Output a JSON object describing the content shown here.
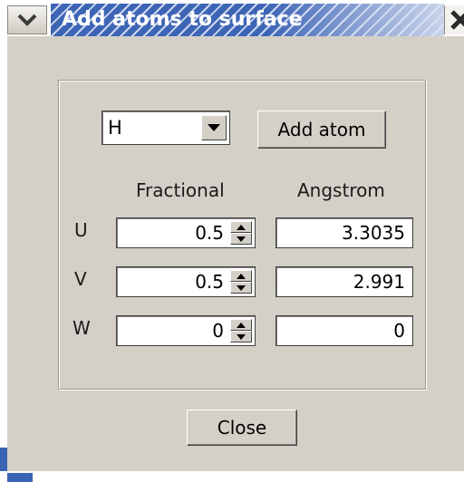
{
  "window": {
    "title": "Add atoms to surface",
    "menu_icon": "chevron-down-icon",
    "close_icon": "close-icon"
  },
  "form": {
    "element_select": {
      "value": "H",
      "icon": "dropdown-arrow-icon"
    },
    "add_atom_label": "Add atom",
    "columns": {
      "fractional": "Fractional",
      "angstrom": "Angstrom"
    },
    "rows": [
      {
        "label": "U",
        "fractional": "0.5",
        "angstrom": "3.3035"
      },
      {
        "label": "V",
        "fractional": "0.5",
        "angstrom": "2.991"
      },
      {
        "label": "W",
        "fractional": "0",
        "angstrom": "0"
      }
    ],
    "close_label": "Close"
  },
  "colors": {
    "title_bar": "#3e65b5",
    "window_bg": "#d4d0c8"
  }
}
